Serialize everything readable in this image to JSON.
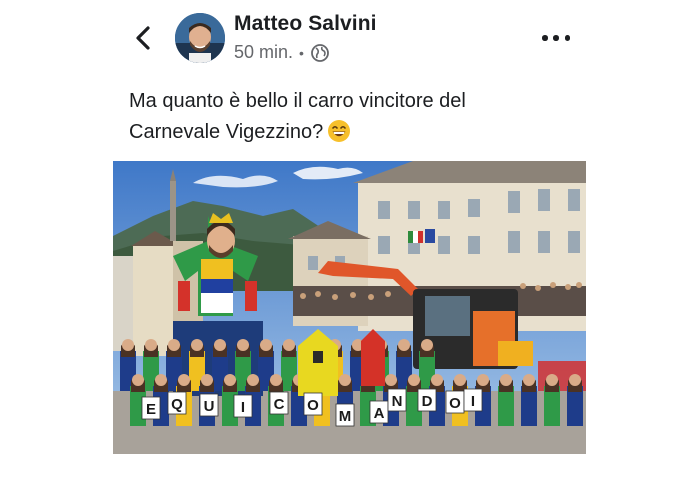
{
  "post": {
    "author": "Matteo Salvini",
    "time": "50 min.",
    "separator": "•",
    "text_line1": "Ma quanto è bello il carro vincitore del",
    "text_line2": "Carnevale Vigezzino?",
    "emoji": "grinning-face-with-smiling-eyes-icon"
  },
  "icons": {
    "back": "chevron-left-icon",
    "privacy": "globe-icon",
    "menu": "more-horizontal-icon"
  },
  "photo": {
    "banner_letters": [
      "E",
      "Q",
      "U",
      "I",
      "C",
      "O",
      "M",
      "A",
      "N",
      "D",
      "O",
      "I"
    ]
  },
  "colors": {
    "text": "#1c1e21",
    "secondary": "#65676b",
    "background": "#ffffff"
  }
}
